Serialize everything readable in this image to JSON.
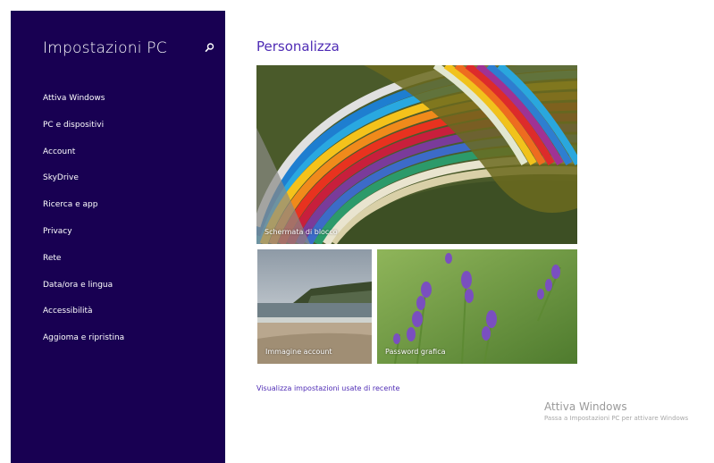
{
  "sidebar": {
    "title": "Impostazioni PC",
    "search_icon": "search-icon",
    "items": [
      {
        "label": "Attiva Windows"
      },
      {
        "label": "PC e dispositivi"
      },
      {
        "label": "Account"
      },
      {
        "label": "SkyDrive"
      },
      {
        "label": "Ricerca e app"
      },
      {
        "label": "Privacy"
      },
      {
        "label": "Rete"
      },
      {
        "label": "Data/ora e lingua"
      },
      {
        "label": "Accessibilità"
      },
      {
        "label": "Aggioma e ripristina"
      }
    ]
  },
  "main": {
    "title": "Personalizza",
    "tiles": {
      "lock": "Schermata di blocco",
      "account": "Immagine account",
      "password": "Password grafica"
    },
    "recent_link": "Visualizza impostazioni usate di recente"
  },
  "watermark": {
    "title": "Attiva Windows",
    "subtitle": "Passa a Impostazioni PC per attivare Windows"
  },
  "colors": {
    "sidebar_bg": "#180052",
    "accent": "#4f2cb5"
  }
}
